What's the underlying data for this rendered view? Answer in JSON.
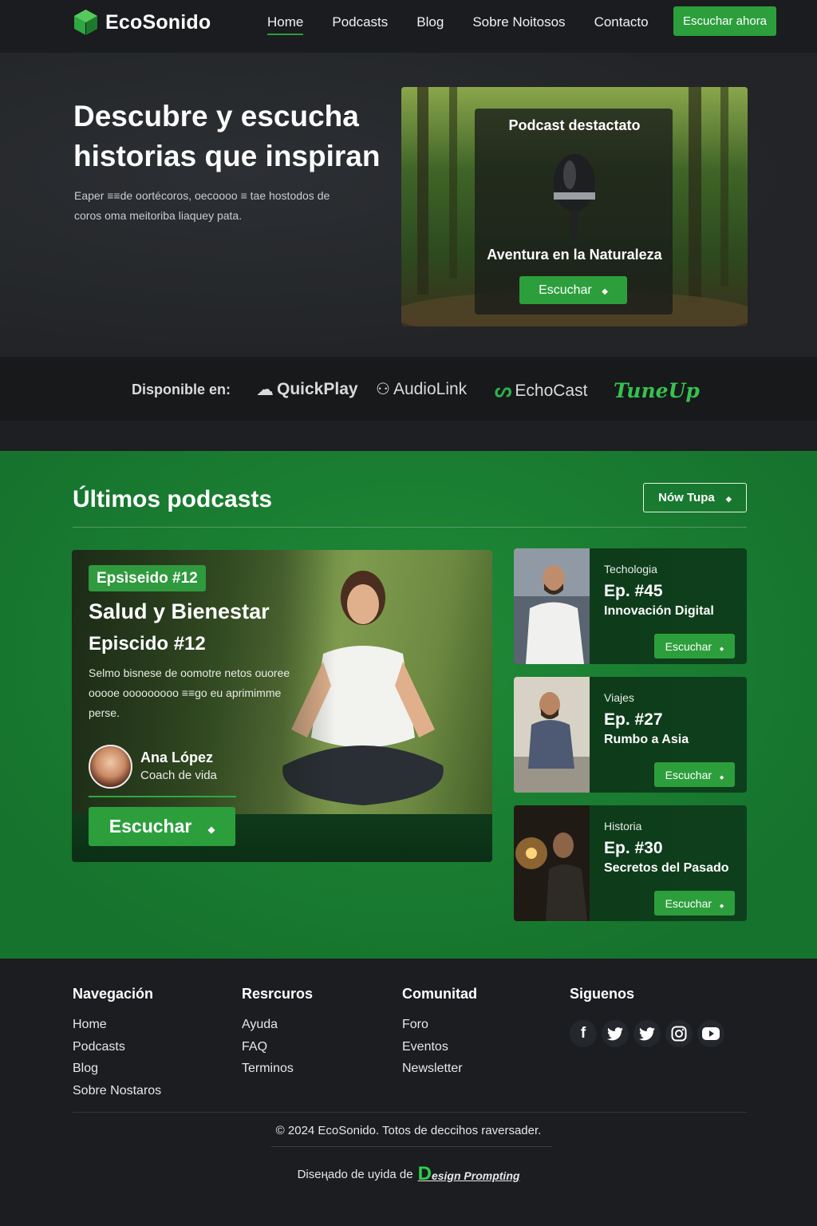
{
  "brand": {
    "name": "EcoSonido",
    "accent": "#2c9f3c"
  },
  "nav": {
    "items": [
      {
        "label": "Home",
        "active": true
      },
      {
        "label": "Podcasts"
      },
      {
        "label": "Blog"
      },
      {
        "label": "Sobre Noitosos"
      },
      {
        "label": "Contacto"
      }
    ],
    "cta": "Escuchar ahora"
  },
  "hero": {
    "title": "Descubre y escucha historias que inspiran",
    "subtitle": "Eaper ≡≡de oortécoros, oecoooo ≡ tae hostodos de coros oma meitoriba liaquey pata."
  },
  "featured": {
    "label": "Podcast destactato",
    "name": "Aventura en la Naturaleza",
    "button": "Escuchar"
  },
  "platforms": {
    "label": "Disponible en:",
    "items": [
      "QuickPlay",
      "AudioLink",
      "EchoCast",
      "TuneUp"
    ]
  },
  "latest": {
    "title": "Últimos podcasts",
    "filter_button": "Nów Tupa",
    "main": {
      "tag": "Epsìseido #12",
      "title": "Salud y Bienestar",
      "subtitle": "Episcido #12",
      "description": "Selmo bisnese de oomotre netos ouoree ooooe ooooooooo ≡≡go eu aprimimme perse.",
      "author_name": "Ana López",
      "author_role": "Coach de vida",
      "button": "Escuchar"
    },
    "episodes": [
      {
        "category": "Techologia",
        "number": "Ep. #45",
        "name": "Innovación Digital",
        "button": "Escuchar"
      },
      {
        "category": "Viajes",
        "number": "Ep. #27",
        "name": "Rumbo a Asia",
        "button": "Escuchar"
      },
      {
        "category": "Historia",
        "number": "Ep. #30",
        "name": "Secretos del Pasado",
        "button": "Escuchar"
      }
    ]
  },
  "footer": {
    "columns": [
      {
        "title": "Navegación",
        "links": [
          "Home",
          "Podcasts",
          "Blog",
          "Sobre Nostaros"
        ]
      },
      {
        "title": "Resrcuros",
        "links": [
          "Ayuda",
          "FAQ",
          "Terminos"
        ]
      },
      {
        "title": "Comunitad",
        "links": [
          "Foro",
          "Eventos",
          "Newsletter"
        ]
      }
    ],
    "social_title": "Siguenos",
    "social_icons": [
      "facebook-icon",
      "twitter-icon",
      "twitter-icon",
      "instagram-icon",
      "youtube-icon"
    ],
    "copyright": "© 2024 EcoSonido. Totos de deccihos raversader.",
    "credit_prefix": "Diseңado de uyida de",
    "credit_brand_letter": "D",
    "credit_brand": "esign Prompting"
  }
}
